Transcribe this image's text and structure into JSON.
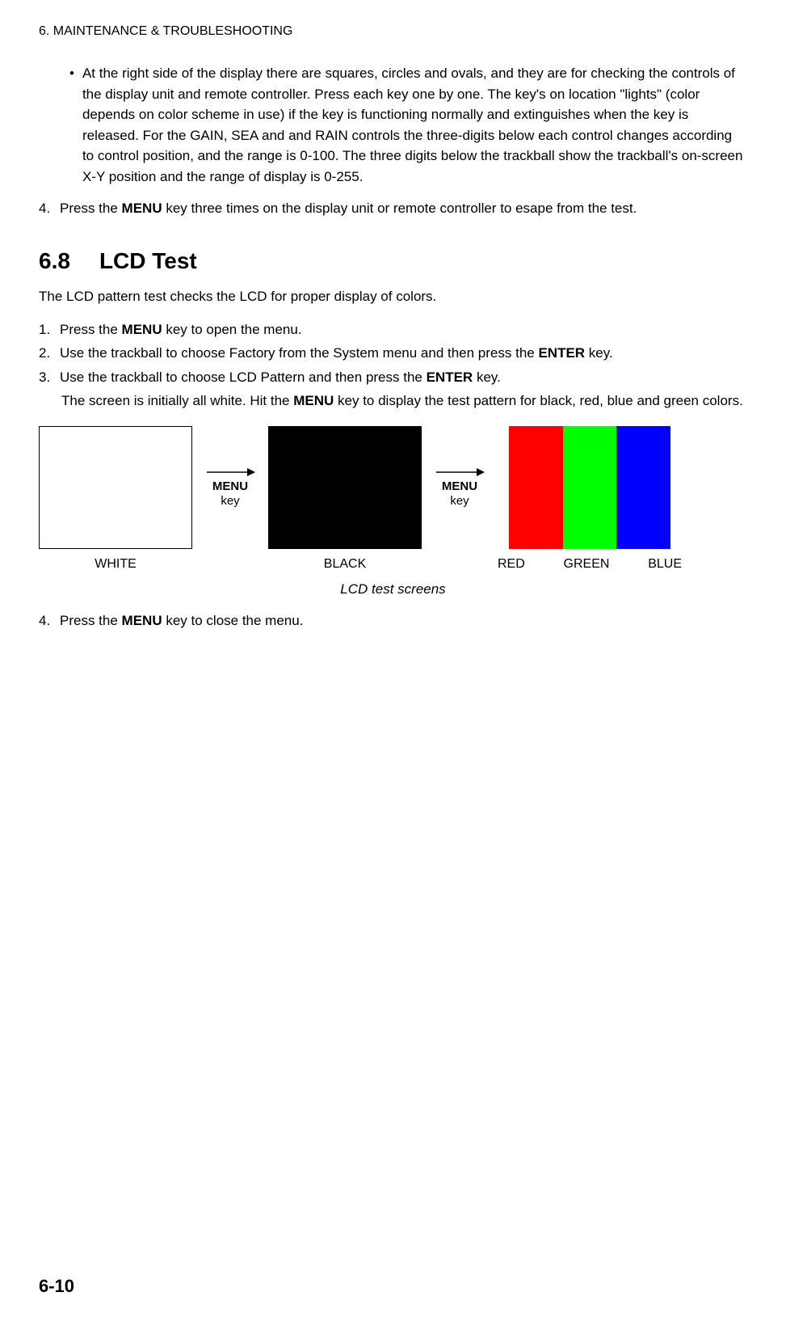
{
  "header": "6. MAINTENANCE & TROUBLESHOOTING",
  "bullet": {
    "text": "At the right side of the display there are squares, circles and ovals, and they are for checking the controls of the display unit and remote controller. Press each key one by one. The key's on location \"lights\" (color depends on color scheme in use) if the key is functioning normally and extinguishes when the key is released. For the GAIN, SEA and and RAIN controls the three-digits below each control changes according to control position, and the range is 0-100. The three digits below the trackball show the trackball's on-screen X-Y position and the range of display is 0-255."
  },
  "step4a": {
    "num": "4.",
    "pre": "Press the ",
    "bold": "MENU",
    "post": " key three times on the display unit or remote controller to esape from the test."
  },
  "section": {
    "number": "6.8",
    "title": "LCD Test"
  },
  "intro": "The LCD pattern test checks the LCD for proper display of colors.",
  "steps": {
    "s1": {
      "num": "1.",
      "pre": "Press the ",
      "bold": "MENU",
      "post": " key to open the menu."
    },
    "s2": {
      "num": "2.",
      "pre": "Use the trackball to choose Factory from the System menu and then press the ",
      "bold": "ENTER",
      "post": " key."
    },
    "s3": {
      "num": "3.",
      "pre": "Use the trackball to choose LCD Pattern and then press the ",
      "bold": "ENTER",
      "post": " key."
    },
    "note": {
      "pre": "The screen is initially all white. Hit the ",
      "bold": "MENU",
      "post": " key to display the test pattern for black, red, blue and green colors."
    },
    "s4": {
      "num": "4.",
      "pre": "Press the ",
      "bold": "MENU",
      "post": " key to close the menu."
    }
  },
  "diagram": {
    "arrow1": {
      "bold": "MENU",
      "sub": "key"
    },
    "arrow2": {
      "bold": "MENU",
      "sub": "key"
    },
    "labels": {
      "white": "WHITE",
      "black": "BLACK",
      "red": "RED",
      "green": "GREEN",
      "blue": "BLUE"
    },
    "caption": "LCD test screens"
  },
  "pageNumber": "6-10"
}
